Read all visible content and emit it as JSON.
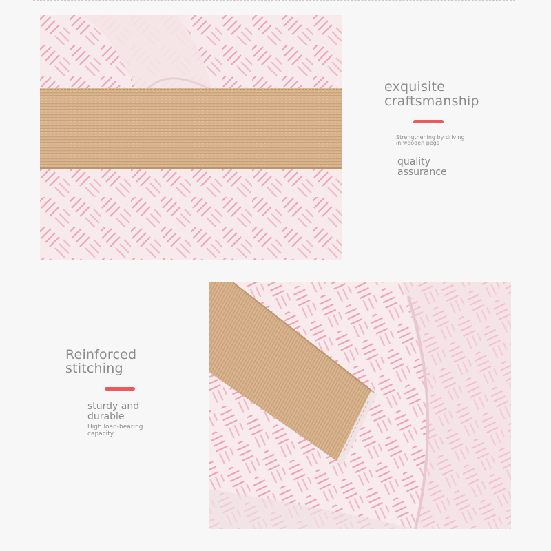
{
  "section1": {
    "title_line1": "exquisite",
    "title_line2": "craftsmanship",
    "note_line1": "Strengthening by driving",
    "note_line2": "in wooden pegs",
    "sub_line1": "quality",
    "sub_line2": "assurance",
    "accent_color": "#ea5a5a"
  },
  "section2": {
    "title_line1": "Reinforced",
    "title_line2": "stitching",
    "sub_line1": "sturdy and",
    "sub_line2": "durable",
    "note_line1": "High load-bearing",
    "note_line2": "capacity",
    "accent_color": "#ea5a5a"
  }
}
